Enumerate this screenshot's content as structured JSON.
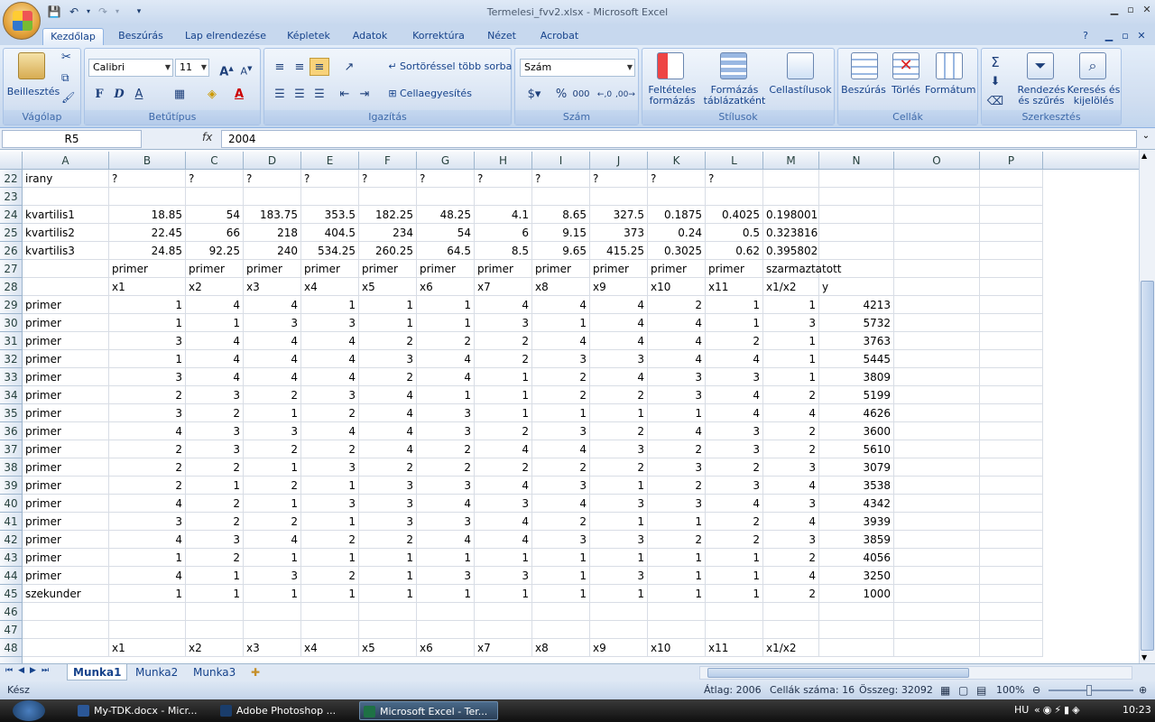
{
  "window": {
    "title": "Termelesi_fvv2.xlsx - Microsoft Excel"
  },
  "tabs": [
    "Kezdőlap",
    "Beszúrás",
    "Lap elrendezése",
    "Képletek",
    "Adatok",
    "Korrektúra",
    "Nézet",
    "Acrobat"
  ],
  "ribbon": {
    "clipboard": {
      "label": "Vágólap",
      "paste": "Beillesztés"
    },
    "font": {
      "label": "Betűtípus",
      "name": "Calibri",
      "size": "11",
      "bold": "F",
      "italic": "D",
      "underline": "A",
      "color_btn": "A"
    },
    "alignment": {
      "label": "Igazítás",
      "wrap": "Sortöréssel több sorba",
      "merge": "Cellaegyesítés"
    },
    "number": {
      "label": "Szám",
      "format": "Szám"
    },
    "styles": {
      "label": "Stílusok",
      "conditional": "Feltételes formázás",
      "table": "Formázás táblázatként",
      "cellstyles": "Cellastílusok"
    },
    "cells": {
      "label": "Cellák",
      "insert": "Beszúrás",
      "delete": "Törlés",
      "format": "Formátum"
    },
    "editing": {
      "label": "Szerkesztés",
      "sort": "Rendezés és szűrés",
      "find": "Keresés és kijelölés"
    }
  },
  "formula_bar": {
    "namebox": "R5",
    "fx": "fx",
    "value": "2004"
  },
  "columns": [
    "A",
    "B",
    "C",
    "D",
    "E",
    "F",
    "G",
    "H",
    "I",
    "J",
    "K",
    "L",
    "M",
    "N",
    "O",
    "P"
  ],
  "rows": [
    {
      "n": "22",
      "cells": [
        "irany",
        "?",
        "?",
        "?",
        "?",
        "?",
        "?",
        "?",
        "?",
        "?",
        "?",
        "?",
        "",
        "",
        "",
        ""
      ]
    },
    {
      "n": "23",
      "cells": [
        "",
        "",
        "",
        "",
        "",
        "",
        "",
        "",
        "",
        "",
        "",
        "",
        "",
        "",
        "",
        ""
      ]
    },
    {
      "n": "24",
      "cells": [
        "kvartilis1",
        "18.85",
        "54",
        "183.75",
        "353.5",
        "182.25",
        "48.25",
        "4.1",
        "8.65",
        "327.5",
        "0.1875",
        "0.4025",
        "0.198001",
        "",
        "",
        ""
      ]
    },
    {
      "n": "25",
      "cells": [
        "kvartilis2",
        "22.45",
        "66",
        "218",
        "404.5",
        "234",
        "54",
        "6",
        "9.15",
        "373",
        "0.24",
        "0.5",
        "0.323816",
        "",
        "",
        ""
      ]
    },
    {
      "n": "26",
      "cells": [
        "kvartilis3",
        "24.85",
        "92.25",
        "240",
        "534.25",
        "260.25",
        "64.5",
        "8.5",
        "9.65",
        "415.25",
        "0.3025",
        "0.62",
        "0.395802",
        "",
        "",
        ""
      ]
    },
    {
      "n": "27",
      "cells": [
        "",
        "primer",
        "primer",
        "primer",
        "primer",
        "primer",
        "primer",
        "primer",
        "primer",
        "primer",
        "primer",
        "primer",
        "szarmaztatott",
        "",
        "",
        ""
      ]
    },
    {
      "n": "28",
      "cells": [
        "",
        "x1",
        "x2",
        "x3",
        "x4",
        "x5",
        "x6",
        "x7",
        "x8",
        "x9",
        "x10",
        "x11",
        "x1/x2",
        "y",
        "",
        ""
      ]
    },
    {
      "n": "29",
      "cells": [
        "primer",
        "1",
        "4",
        "4",
        "1",
        "1",
        "1",
        "4",
        "4",
        "4",
        "2",
        "1",
        "1",
        "4213",
        "",
        ""
      ]
    },
    {
      "n": "30",
      "cells": [
        "primer",
        "1",
        "1",
        "3",
        "3",
        "1",
        "1",
        "3",
        "1",
        "4",
        "4",
        "1",
        "3",
        "5732",
        "",
        ""
      ]
    },
    {
      "n": "31",
      "cells": [
        "primer",
        "3",
        "4",
        "4",
        "4",
        "2",
        "2",
        "2",
        "4",
        "4",
        "4",
        "2",
        "1",
        "3763",
        "",
        ""
      ]
    },
    {
      "n": "32",
      "cells": [
        "primer",
        "1",
        "4",
        "4",
        "4",
        "3",
        "4",
        "2",
        "3",
        "3",
        "4",
        "4",
        "1",
        "5445",
        "",
        ""
      ]
    },
    {
      "n": "33",
      "cells": [
        "primer",
        "3",
        "4",
        "4",
        "4",
        "2",
        "4",
        "1",
        "2",
        "4",
        "3",
        "3",
        "1",
        "3809",
        "",
        ""
      ]
    },
    {
      "n": "34",
      "cells": [
        "primer",
        "2",
        "3",
        "2",
        "3",
        "4",
        "1",
        "1",
        "2",
        "2",
        "3",
        "4",
        "2",
        "5199",
        "",
        ""
      ]
    },
    {
      "n": "35",
      "cells": [
        "primer",
        "3",
        "2",
        "1",
        "2",
        "4",
        "3",
        "1",
        "1",
        "1",
        "1",
        "4",
        "4",
        "4626",
        "",
        ""
      ]
    },
    {
      "n": "36",
      "cells": [
        "primer",
        "4",
        "3",
        "3",
        "4",
        "4",
        "3",
        "2",
        "3",
        "2",
        "4",
        "3",
        "2",
        "3600",
        "",
        ""
      ]
    },
    {
      "n": "37",
      "cells": [
        "primer",
        "2",
        "3",
        "2",
        "2",
        "4",
        "2",
        "4",
        "4",
        "3",
        "2",
        "3",
        "2",
        "5610",
        "",
        ""
      ]
    },
    {
      "n": "38",
      "cells": [
        "primer",
        "2",
        "2",
        "1",
        "3",
        "2",
        "2",
        "2",
        "2",
        "2",
        "3",
        "2",
        "3",
        "3079",
        "",
        ""
      ]
    },
    {
      "n": "39",
      "cells": [
        "primer",
        "2",
        "1",
        "2",
        "1",
        "3",
        "3",
        "4",
        "3",
        "1",
        "2",
        "3",
        "4",
        "3538",
        "",
        ""
      ]
    },
    {
      "n": "40",
      "cells": [
        "primer",
        "4",
        "2",
        "1",
        "3",
        "3",
        "4",
        "3",
        "4",
        "3",
        "3",
        "4",
        "3",
        "4342",
        "",
        ""
      ]
    },
    {
      "n": "41",
      "cells": [
        "primer",
        "3",
        "2",
        "2",
        "1",
        "3",
        "3",
        "4",
        "2",
        "1",
        "1",
        "2",
        "4",
        "3939",
        "",
        ""
      ]
    },
    {
      "n": "42",
      "cells": [
        "primer",
        "4",
        "3",
        "4",
        "2",
        "2",
        "4",
        "4",
        "3",
        "3",
        "2",
        "2",
        "3",
        "3859",
        "",
        ""
      ]
    },
    {
      "n": "43",
      "cells": [
        "primer",
        "1",
        "2",
        "1",
        "1",
        "1",
        "1",
        "1",
        "1",
        "1",
        "1",
        "1",
        "2",
        "4056",
        "",
        ""
      ]
    },
    {
      "n": "44",
      "cells": [
        "primer",
        "4",
        "1",
        "3",
        "2",
        "1",
        "3",
        "3",
        "1",
        "3",
        "1",
        "1",
        "4",
        "3250",
        "",
        ""
      ]
    },
    {
      "n": "45",
      "cells": [
        "szekunder",
        "1",
        "1",
        "1",
        "1",
        "1",
        "1",
        "1",
        "1",
        "1",
        "1",
        "1",
        "2",
        "1000",
        "",
        ""
      ]
    },
    {
      "n": "46",
      "cells": [
        "",
        "",
        "",
        "",
        "",
        "",
        "",
        "",
        "",
        "",
        "",
        "",
        "",
        "",
        "",
        ""
      ]
    },
    {
      "n": "47",
      "cells": [
        "",
        "",
        "",
        "",
        "",
        "",
        "",
        "",
        "",
        "",
        "",
        "",
        "",
        "",
        "",
        ""
      ]
    },
    {
      "n": "48",
      "cells": [
        "",
        "x1",
        "x2",
        "x3",
        "x4",
        "x5",
        "x6",
        "x7",
        "x8",
        "x9",
        "x10",
        "x11",
        "x1/x2",
        "",
        "",
        ""
      ]
    }
  ],
  "sheets": [
    "Munka1",
    "Munka2",
    "Munka3"
  ],
  "status": {
    "ready": "Kész",
    "avg": "Átlag: 2006",
    "count": "Cellák száma: 16",
    "sum": "Összeg: 32092",
    "zoom": "100%"
  },
  "taskbar": {
    "items": [
      "My-TDK.docx - Micr...",
      "Adobe Photoshop ...",
      "Microsoft Excel - Ter..."
    ],
    "lang": "HU",
    "clock": "10:23"
  }
}
